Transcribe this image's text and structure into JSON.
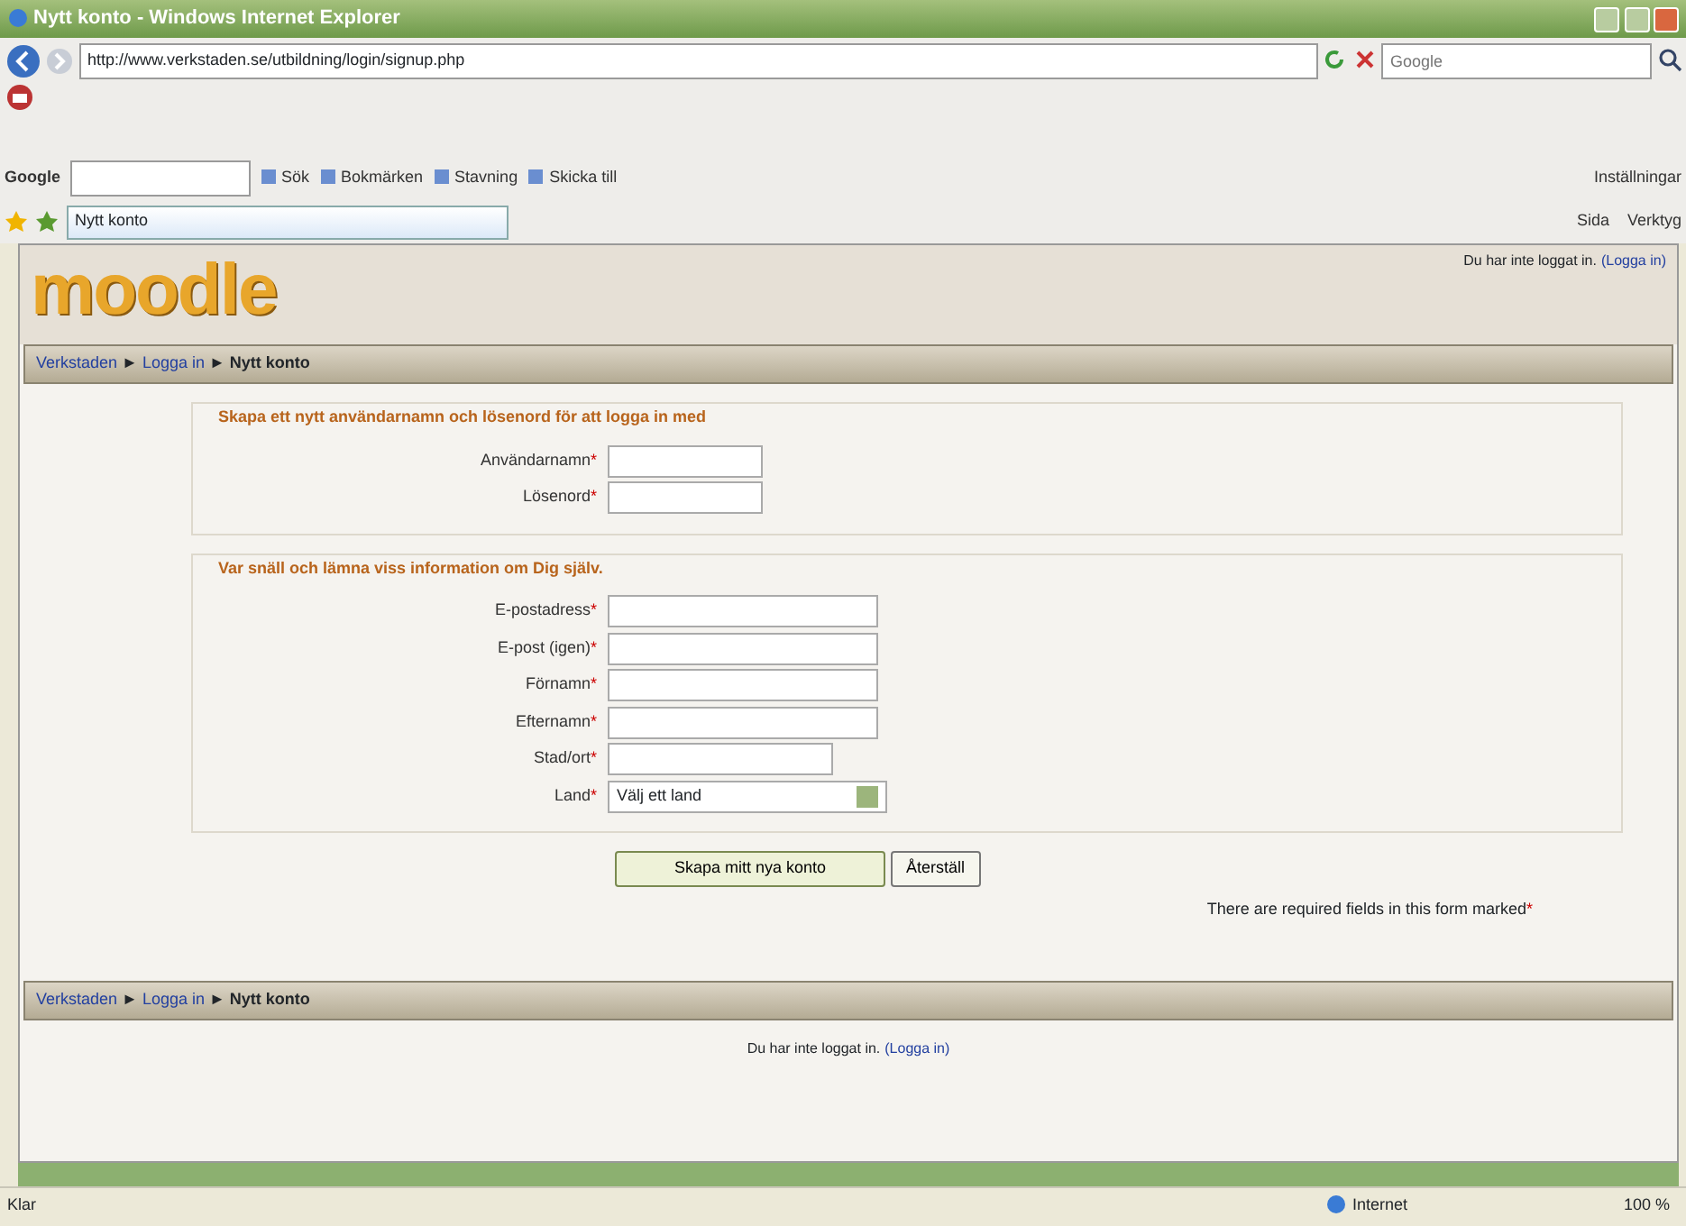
{
  "window": {
    "title": "Nytt konto - Windows Internet Explorer"
  },
  "address_bar": {
    "url": "http://www.verkstaden.se/utbildning/login/signup.php"
  },
  "search": {
    "placeholder": "Google"
  },
  "google_toolbar": {
    "brand": "Google",
    "items": [
      {
        "label": "Sök"
      },
      {
        "label": "Bokmärken"
      },
      {
        "label": "Stavning"
      },
      {
        "label": "Skicka till"
      }
    ],
    "settings": "Inställningar"
  },
  "tabs": [
    {
      "label": "Nytt konto",
      "selected": true
    }
  ],
  "command_bar": {
    "items": [
      {
        "label": "Sida"
      },
      {
        "label": "Verktyg"
      }
    ]
  },
  "page": {
    "logo": "moodle",
    "login_info": {
      "text": "Du har inte loggat in.",
      "link": "(Logga in)"
    },
    "breadcrumb": [
      {
        "label": "Verkstaden",
        "link": true
      },
      {
        "label": "Logga in",
        "link": true
      },
      {
        "label": "Nytt konto",
        "link": false
      }
    ],
    "separator": "►",
    "sections": [
      {
        "legend": "Skapa ett nytt användarnamn och lösenord för att logga in med",
        "fields": [
          {
            "label": "Användarnamn",
            "mark": "*",
            "kind": "short"
          },
          {
            "label": "Lösenord",
            "mark": "*",
            "kind": "short"
          }
        ]
      },
      {
        "legend": "Var snäll och lämna viss information om Dig själv.",
        "fields": [
          {
            "label": "E-postadress",
            "mark": "*",
            "kind": "long"
          },
          {
            "label": "E-post (igen)",
            "mark": "*",
            "kind": "long"
          },
          {
            "label": "Förnamn",
            "mark": "*",
            "kind": "long"
          },
          {
            "label": "Efternamn",
            "mark": "*",
            "kind": "long"
          },
          {
            "label": "Stad/ort",
            "mark": "*",
            "kind": "medium"
          },
          {
            "label": "Land",
            "mark": "*",
            "kind": "select",
            "value": "Välj ett land"
          }
        ]
      }
    ],
    "buttons": [
      {
        "label": "Skapa mitt nya konto",
        "kind": "primary"
      },
      {
        "label": "Återställ",
        "kind": "plain"
      }
    ],
    "required_note": {
      "text": "There are required fields in this form marked",
      "mark": "*"
    },
    "footer_breadcrumb": [
      {
        "label": "Verkstaden",
        "link": true
      },
      {
        "label": "Logga in",
        "link": true
      },
      {
        "label": "Nytt konto",
        "link": false
      }
    ],
    "footer_login": {
      "text": "Du har inte loggat in.",
      "link": "(Logga in)"
    }
  },
  "status_bar": {
    "text": "Klar",
    "zone": "Internet",
    "zoom": "100 %"
  }
}
